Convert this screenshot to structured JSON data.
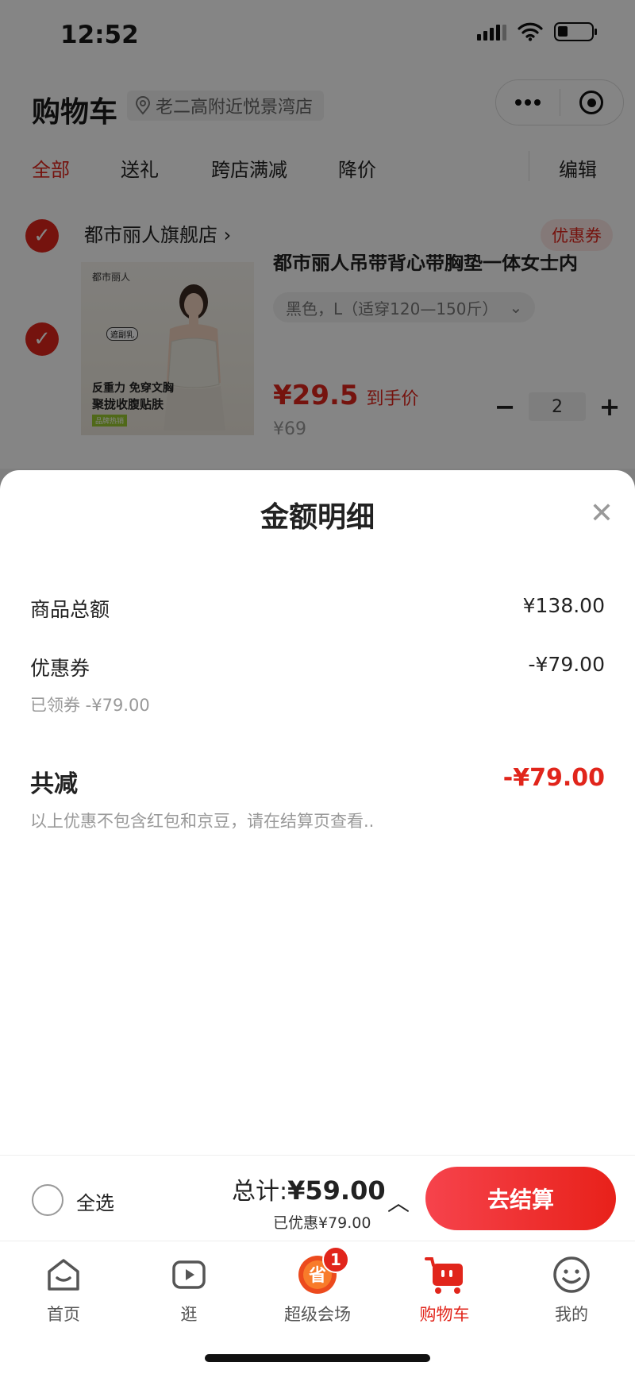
{
  "status_bar": {
    "time": "12:52"
  },
  "header": {
    "title": "购物车",
    "location": "老二高附近悦景湾店"
  },
  "tabs": [
    {
      "label": "全部",
      "active": true
    },
    {
      "label": "送礼",
      "active": false
    },
    {
      "label": "跨店满减",
      "active": false
    },
    {
      "label": "降价",
      "active": false
    }
  ],
  "edit_label": "编辑",
  "store": {
    "name": "都市丽人旗舰店",
    "coupon_label": "优惠券"
  },
  "product": {
    "title": "都市丽人吊带背心带胸垫一体女士内",
    "sku": "黑色，L（适穿120—150斤）",
    "price_main": "¥29.5",
    "price_suffix": "到手价",
    "original_price": "¥69",
    "quantity": "2",
    "image": {
      "brand": "都市丽人",
      "label": "遮副乳",
      "promo_line1": "反重力 免穿文胸",
      "promo_line2": "聚拢收腹贴肤",
      "badge": "品牌热销"
    }
  },
  "sheet": {
    "title": "金额明细",
    "rows": {
      "goods_total_label": "商品总额",
      "goods_total_value": "¥138.00",
      "coupon_label": "优惠券",
      "coupon_value": "-¥79.00",
      "coupon_note": "已领券 -¥79.00"
    },
    "total": {
      "label": "共减",
      "value": "-¥79.00",
      "note": "以上优惠不包含红包和京豆，请在结算页查看.."
    }
  },
  "checkout": {
    "select_all": "全选",
    "sum_label": "总计:",
    "sum_value": "¥59.00",
    "saved": "已优惠¥79.00",
    "pay_button": "去结算"
  },
  "tabbar": [
    {
      "label": "首页",
      "icon": "home-icon"
    },
    {
      "label": "逛",
      "icon": "video-icon"
    },
    {
      "label": "超级会场",
      "icon": "sheng-icon",
      "badge": "1"
    },
    {
      "label": "购物车",
      "icon": "cart-icon",
      "active": true
    },
    {
      "label": "我的",
      "icon": "profile-icon"
    }
  ],
  "colors": {
    "accent": "#e1251b"
  }
}
